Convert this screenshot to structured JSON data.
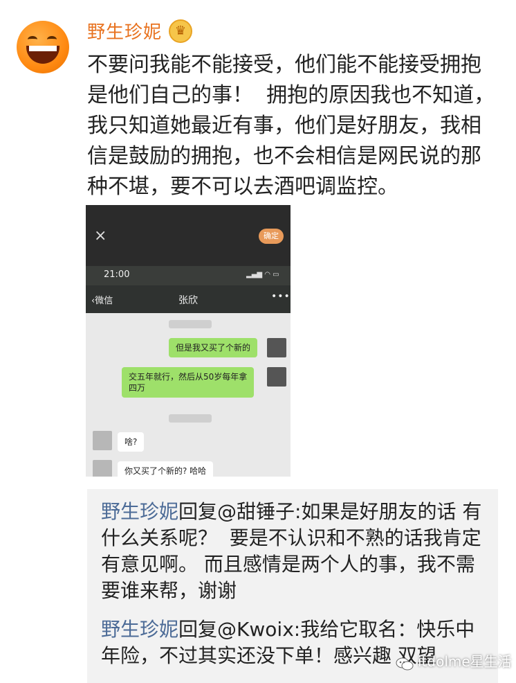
{
  "post": {
    "username": "野生珍妮",
    "vip_icon": "crown-badge-icon",
    "text": "不要问我能不能接受，他们能不能接受拥抱\n是他们自己的事！  拥抱的原因我也不知道，\n我只知道她最近有事，他们是好朋友，我相\n信是鼓励的拥抱，也不会相信是网民说的那\n种不堪，要不可以去酒吧调监控。"
  },
  "screenshot": {
    "close_icon": "×",
    "button_label": "确定",
    "time": "21:00",
    "status_icons": "▂▄▆ ◠ ▭",
    "back_label": "‹微信",
    "contact_name": "张欣",
    "more_icon": "•••",
    "messages": [
      {
        "side": "right",
        "text": "但是我又买了个新的"
      },
      {
        "side": "right",
        "text": "交五年就行，然后从50岁每年拿\n四万"
      },
      {
        "side": "left",
        "text": "啥?"
      },
      {
        "side": "left",
        "text": "你又买了个新的? 哈哈"
      }
    ]
  },
  "replies": [
    {
      "name": "野生珍妮",
      "text": "回复@甜锤子:如果是好朋友的话 有\n什么关系呢？  要是不认识和不熟的话我肯定\n有意见啊。 而且感情是两个人的事，我不需\n要谁来帮，谢谢"
    },
    {
      "name": "野生珍妮",
      "text": "回复@Kwoix:我给它取名：快乐中\n年险，不过其实还没下单！感兴趣 双望"
    }
  ],
  "watermark": {
    "text": "itdolme星生活",
    "icon": "wechat-icon"
  },
  "colors": {
    "username": "#e8721f",
    "reply_name": "#4c6b97",
    "bubble_green": "#9ee06a"
  }
}
